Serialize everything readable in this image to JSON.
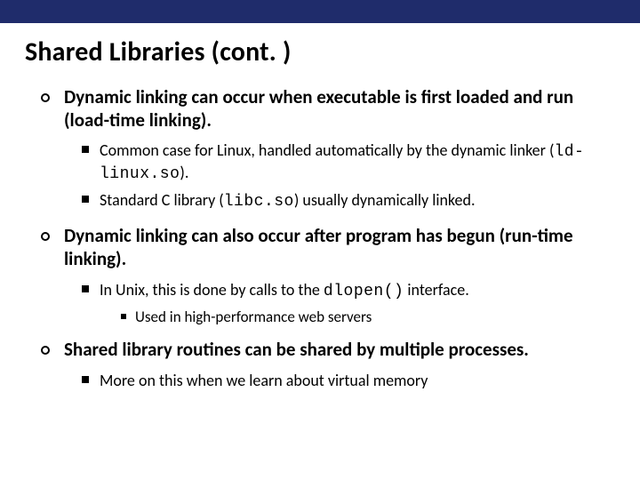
{
  "title": "Shared Libraries (cont. )",
  "bullets": {
    "b1": {
      "text": "Dynamic linking can occur when executable is first loaded and run (load-time linking).",
      "sub": {
        "s1_a": "Common case for Linux, handled automatically by the dynamic linker (",
        "s1_code": "ld-linux.so",
        "s1_b": ").",
        "s2_a": "Standard C library (",
        "s2_code": "libc.so",
        "s2_b": ") usually dynamically linked."
      }
    },
    "b2": {
      "text": "Dynamic linking can also occur after program has begun (run-time linking).",
      "sub": {
        "s1_a": "In Unix, this is done by calls to the ",
        "s1_code": "dlopen()",
        "s1_b": " interface.",
        "sub2": {
          "t1": "Used in high-performance web servers"
        }
      }
    },
    "b3": {
      "text": "Shared library routines can be shared by multiple processes.",
      "sub": {
        "s1": "More on this when we learn about virtual memory"
      }
    }
  }
}
